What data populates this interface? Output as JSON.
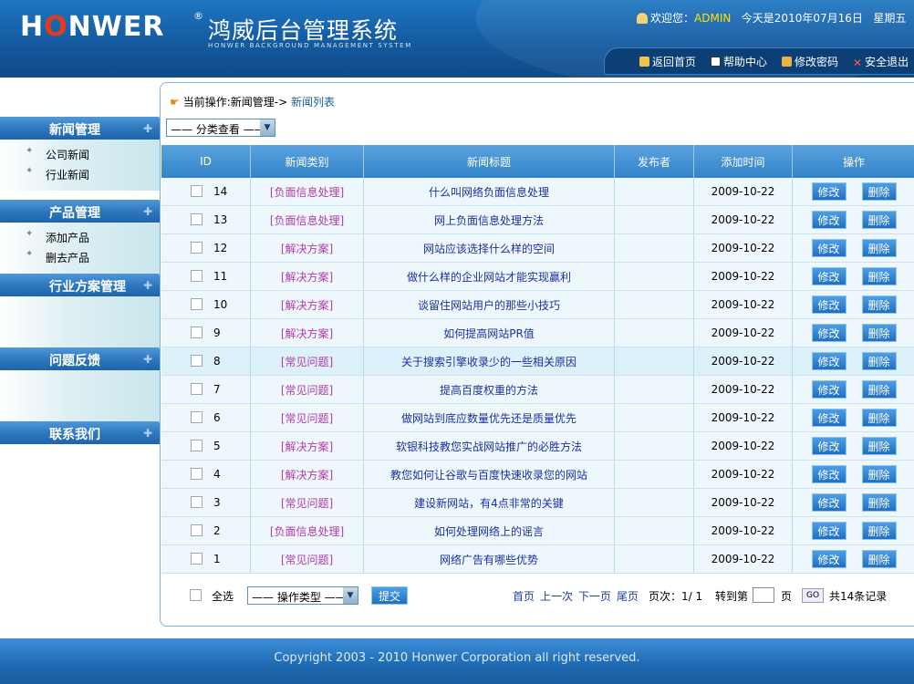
{
  "header": {
    "logo_pre": "H",
    "logo_o": "O",
    "logo_post": "NWER",
    "logo_reg": "®",
    "title_cn": "鸿威后台管理系统",
    "title_en": "HONWER BACKGROUND MANAGEMENT SYSTEM",
    "welcome_prefix": "欢迎您：",
    "username": "ADMIN",
    "date_text": "今天是2010年07月16日",
    "weekday": "星期五",
    "nav": [
      {
        "label": "返回首页",
        "icon": "home-icon"
      },
      {
        "label": "帮助中心",
        "icon": "help-icon"
      },
      {
        "label": "修改密码",
        "icon": "lock-icon"
      },
      {
        "label": "安全退出",
        "icon": "exit-icon"
      }
    ]
  },
  "sidebar": {
    "groups": [
      {
        "title": "新闻管理",
        "items": [
          "公司新闻",
          "行业新闻"
        ]
      },
      {
        "title": "产品管理",
        "items": [
          "添加产品",
          "删去产品"
        ]
      },
      {
        "title": "行业方案管理",
        "items": []
      },
      {
        "title": "问题反馈",
        "items": []
      },
      {
        "title": "联系我们",
        "items": []
      }
    ]
  },
  "main": {
    "breadcrumb_prefix": "当前操作:新闻管理->",
    "breadcrumb_current": "新闻列表",
    "category_filter": "—— 分类查看 ——",
    "columns": [
      "ID",
      "新闻类别",
      "新闻标题",
      "发布者",
      "添加时间",
      "操作"
    ],
    "edit_label": "修改",
    "delete_label": "删除",
    "rows": [
      {
        "id": "14",
        "category": "[负面信息处理]",
        "title": "什么叫网络负面信息处理",
        "author": "",
        "date": "2009-10-22"
      },
      {
        "id": "13",
        "category": "[负面信息处理]",
        "title": "网上负面信息处理方法",
        "author": "",
        "date": "2009-10-22"
      },
      {
        "id": "12",
        "category": "[解决方案]",
        "title": "网站应该选择什么样的空间",
        "author": "",
        "date": "2009-10-22"
      },
      {
        "id": "11",
        "category": "[解决方案]",
        "title": "做什么样的企业网站才能实现赢利",
        "author": "",
        "date": "2009-10-22"
      },
      {
        "id": "10",
        "category": "[解决方案]",
        "title": "谈留住网站用户的那些小技巧",
        "author": "",
        "date": "2009-10-22"
      },
      {
        "id": "9",
        "category": "[解决方案]",
        "title": "如何提高网站PR值",
        "author": "",
        "date": "2009-10-22"
      },
      {
        "id": "8",
        "category": "[常见问题]",
        "title": "关于搜索引擎收录少的一些相关原因",
        "author": "",
        "date": "2009-10-22"
      },
      {
        "id": "7",
        "category": "[常见问题]",
        "title": "提高百度权重的方法",
        "author": "",
        "date": "2009-10-22"
      },
      {
        "id": "6",
        "category": "[常见问题]",
        "title": "做网站到底应数量优先还是质量优先",
        "author": "",
        "date": "2009-10-22"
      },
      {
        "id": "5",
        "category": "[解决方案]",
        "title": "软银科技教您实战网站推广的必胜方法",
        "author": "",
        "date": "2009-10-22"
      },
      {
        "id": "4",
        "category": "[解决方案]",
        "title": "教您如何让谷歌与百度快速收录您的网站",
        "author": "",
        "date": "2009-10-22"
      },
      {
        "id": "3",
        "category": "[常见问题]",
        "title": "建设新网站，有4点非常的关键",
        "author": "",
        "date": "2009-10-22"
      },
      {
        "id": "2",
        "category": "[负面信息处理]",
        "title": "如何处理网络上的谣言",
        "author": "",
        "date": "2009-10-22"
      },
      {
        "id": "1",
        "category": "[常见问题]",
        "title": "网络广告有哪些优势",
        "author": "",
        "date": "2009-10-22"
      }
    ],
    "highlighted_row_id": "8",
    "select_all": "全选",
    "action_select": "—— 操作类型 ——",
    "submit": "提交",
    "pager": {
      "first": "首页",
      "prev": "上一次",
      "next": "下一页",
      "last": "尾页",
      "page_info": "页次：1/ 1",
      "goto_prefix": "转到第",
      "goto_suffix": "页",
      "go": "GO",
      "total": "共14条记录"
    }
  },
  "footer": {
    "copyright": "Copyright 2003 - 2010 Honwer Corporation all right reserved."
  }
}
